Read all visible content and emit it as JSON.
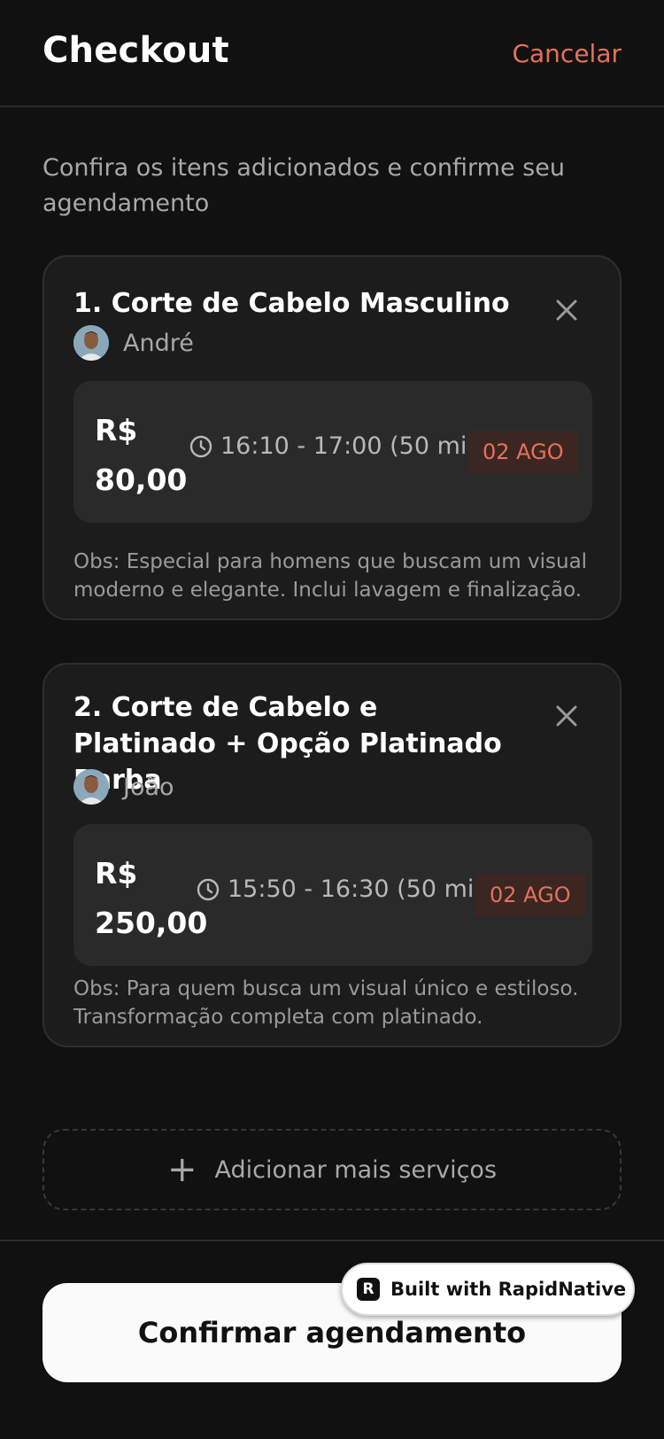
{
  "header": {
    "title": "Checkout",
    "cancel_label": "Cancelar"
  },
  "subtitle": "Confira os itens adicionados e confirme seu agendamento",
  "items": [
    {
      "title": "1. Corte de Cabelo Masculino",
      "professional": "André",
      "price_currency": "R$",
      "price_value": "80,00",
      "time": "16:10 - 17:00 (50 min)",
      "date": "02 AGO",
      "obs": "Obs: Especial para homens que buscam um visual moderno e elegante. Inclui lavagem e finalização."
    },
    {
      "title": "2. Corte de Cabelo e Platinado + Opção Platinado Barba",
      "professional": "João",
      "price_currency": "R$",
      "price_value": "250,00",
      "time": "15:50 - 16:30 (50 min)",
      "date": "02 AGO",
      "obs": "Obs: Para quem busca um visual único e estiloso. Transformação completa com platinado."
    }
  ],
  "add_more_label": "Adicionar mais serviços",
  "confirm_label": "Confirmar agendamento",
  "badge": {
    "text": "Built with RapidNative"
  },
  "colors": {
    "accent": "#e4715d",
    "background": "#111111",
    "card": "#1c1c1c"
  }
}
